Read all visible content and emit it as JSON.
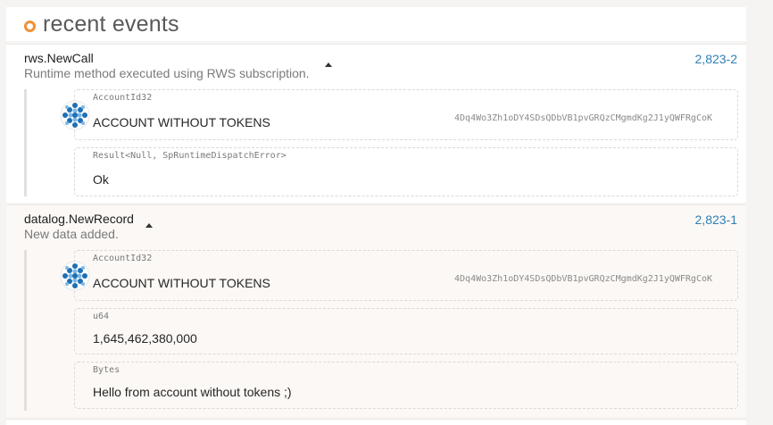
{
  "header": {
    "title": "recent events"
  },
  "events": [
    {
      "method": "rws.NewCall",
      "description": "Runtime method executed using RWS subscription.",
      "id": "2,823-2",
      "params": [
        {
          "type": "AccountId32",
          "value": "ACCOUNT WITHOUT TOKENS",
          "address": "4Dq4Wo3Zh1oDY4SDsQDbVB1pvGRQzCMgmdKg2J1yQWFRgCoK"
        },
        {
          "type": "Result<Null, SpRuntimeDispatchError>",
          "value": "Ok"
        }
      ]
    },
    {
      "method": "datalog.NewRecord",
      "description": "New data added.",
      "id": "2,823-1",
      "params": [
        {
          "type": "AccountId32",
          "value": "ACCOUNT WITHOUT TOKENS",
          "address": "4Dq4Wo3Zh1oDY4SDsQDbVB1pvGRQzCMgmdKg2J1yQWFRgCoK"
        },
        {
          "type": "u64",
          "value": "1,645,462,380,000"
        },
        {
          "type": "Bytes",
          "value": "Hello from account without tokens ;)"
        }
      ]
    }
  ],
  "colors": {
    "accent": "#f19135",
    "link": "#2d7fb5",
    "identicon_blue": "#1f6fb4",
    "identicon_light": "#7ab8e6"
  },
  "icons": {
    "header": "status-dot-icon",
    "toggle": "caret-up-icon",
    "account": "identicon-icon"
  }
}
